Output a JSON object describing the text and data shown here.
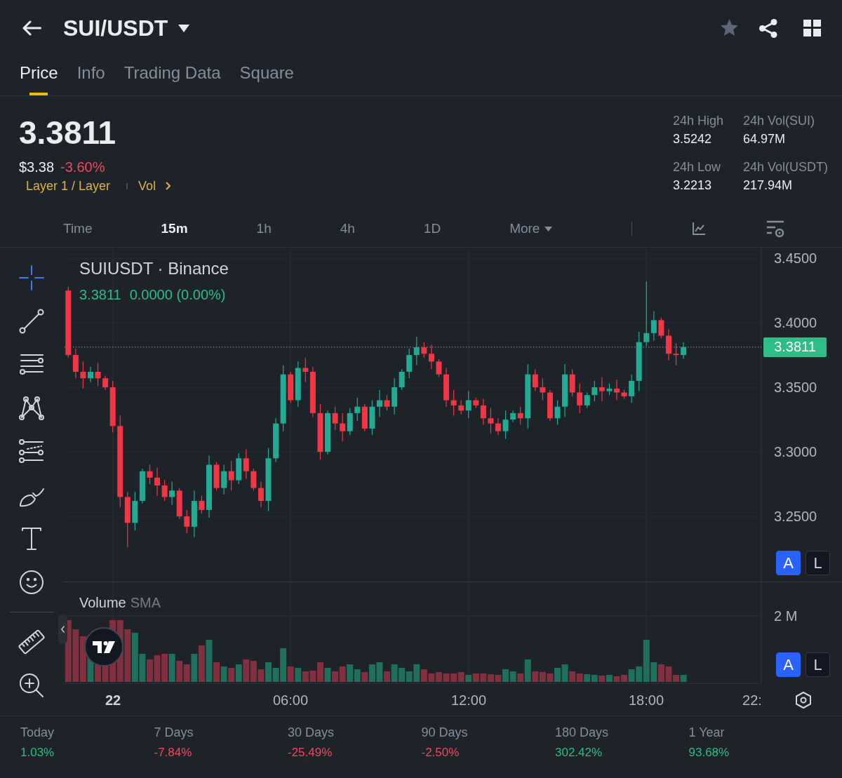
{
  "header": {
    "title": "SUI/USDT",
    "favorite": false
  },
  "tabs": [
    {
      "label": "Price",
      "selected": true
    },
    {
      "label": "Info",
      "selected": false
    },
    {
      "label": "Trading Data",
      "selected": false
    },
    {
      "label": "Square",
      "selected": false
    }
  ],
  "ticker": {
    "last_price": "3.3811",
    "usd_price": "$3.38",
    "change": "-3.60%",
    "positive": false,
    "tag": "Layer 1 / Layer",
    "link": "Vol"
  },
  "stats": [
    {
      "label": "24h High",
      "value": "3.5242"
    },
    {
      "label": "24h Vol(SUI)",
      "value": "64.97M"
    },
    {
      "label": "24h Low",
      "value": "3.2213"
    },
    {
      "label": "24h Vol(USDT)",
      "value": "217.94M"
    }
  ],
  "intervals": [
    {
      "label": "Time",
      "kind": "option",
      "selected": false
    },
    {
      "label": "15m",
      "kind": "option",
      "selected": true
    },
    {
      "label": "1h",
      "kind": "option",
      "selected": false
    },
    {
      "label": "4h",
      "kind": "option",
      "selected": false
    },
    {
      "label": "1D",
      "kind": "option",
      "selected": false
    },
    {
      "label": "More",
      "kind": "menu",
      "selected": false
    }
  ],
  "drawing_tools": [
    {
      "selected": true
    },
    {
      "selected": false
    },
    {
      "selected": false
    },
    {
      "selected": false
    },
    {
      "selected": false
    },
    {
      "selected": false
    },
    {
      "selected": false
    },
    {
      "selected": false
    },
    {
      "selected": false
    },
    {
      "selected": false
    }
  ],
  "chart": {
    "legend": {
      "symbol": "SUIUSDT · Binance",
      "price": "3.3811",
      "change": "0.0000 (0.00%)",
      "positive": true
    },
    "chart_data": {
      "type": "candlestick",
      "categories": [
        null,
        null,
        null,
        null,
        null,
        null,
        null,
        null,
        null,
        null,
        null,
        null,
        null,
        null,
        null,
        null,
        null,
        null,
        null,
        null,
        null,
        null,
        null,
        null,
        null,
        null,
        null,
        null,
        null,
        null,
        null,
        null,
        null,
        null,
        null,
        null,
        null,
        null,
        null,
        null,
        null,
        null,
        null,
        null,
        null,
        null,
        null,
        null,
        null,
        null,
        null,
        null,
        null,
        null,
        null,
        null,
        null,
        null,
        null,
        null,
        null,
        null,
        null,
        null,
        null,
        null,
        null,
        null,
        null,
        null,
        null,
        null,
        null,
        null,
        null,
        null,
        null,
        null,
        null,
        null,
        null,
        null,
        null,
        null,
        null,
        null,
        null,
        null,
        null,
        null,
        null,
        null,
        null,
        null
      ],
      "ohlc": [
        [
          3.425,
          3.428,
          3.373,
          3.375
        ],
        [
          3.375,
          3.38,
          3.357,
          3.362
        ],
        [
          3.362,
          3.37,
          3.349,
          3.357
        ],
        [
          3.357,
          3.366,
          3.354,
          3.362
        ],
        [
          3.362,
          3.369,
          3.351,
          3.357
        ],
        [
          3.357,
          3.359,
          3.348,
          3.35
        ],
        [
          3.35,
          3.355,
          3.315,
          3.32
        ],
        [
          3.32,
          3.328,
          3.257,
          3.265
        ],
        [
          3.265,
          3.269,
          3.226,
          3.245
        ],
        [
          3.245,
          3.269,
          3.239,
          3.262
        ],
        [
          3.262,
          3.287,
          3.26,
          3.285
        ],
        [
          3.285,
          3.29,
          3.275,
          3.28
        ],
        [
          3.28,
          3.288,
          3.266,
          3.274
        ],
        [
          3.274,
          3.278,
          3.262,
          3.265
        ],
        [
          3.265,
          3.277,
          3.259,
          3.27
        ],
        [
          3.27,
          3.272,
          3.248,
          3.25
        ],
        [
          3.25,
          3.255,
          3.237,
          3.242
        ],
        [
          3.242,
          3.27,
          3.234,
          3.262
        ],
        [
          3.262,
          3.266,
          3.252,
          3.255
        ],
        [
          3.255,
          3.297,
          3.249,
          3.29
        ],
        [
          3.29,
          3.292,
          3.27,
          3.272
        ],
        [
          3.272,
          3.29,
          3.267,
          3.285
        ],
        [
          3.285,
          3.293,
          3.27,
          3.278
        ],
        [
          3.278,
          3.299,
          3.275,
          3.295
        ],
        [
          3.295,
          3.302,
          3.279,
          3.285
        ],
        [
          3.285,
          3.287,
          3.27,
          3.272
        ],
        [
          3.272,
          3.277,
          3.257,
          3.262
        ],
        [
          3.262,
          3.303,
          3.254,
          3.295
        ],
        [
          3.295,
          3.326,
          3.292,
          3.322
        ],
        [
          3.322,
          3.367,
          3.316,
          3.36
        ],
        [
          3.36,
          3.362,
          3.338,
          3.34
        ],
        [
          3.34,
          3.37,
          3.335,
          3.365
        ],
        [
          3.365,
          3.373,
          3.354,
          3.362
        ],
        [
          3.362,
          3.366,
          3.327,
          3.33
        ],
        [
          3.33,
          3.337,
          3.294,
          3.3
        ],
        [
          3.3,
          3.332,
          3.298,
          3.33
        ],
        [
          3.33,
          3.335,
          3.317,
          3.322
        ],
        [
          3.322,
          3.33,
          3.308,
          3.316
        ],
        [
          3.316,
          3.334,
          3.313,
          3.33
        ],
        [
          3.33,
          3.342,
          3.324,
          3.335
        ],
        [
          3.335,
          3.337,
          3.316,
          3.318
        ],
        [
          3.318,
          3.34,
          3.313,
          3.335
        ],
        [
          3.335,
          3.348,
          3.327,
          3.34
        ],
        [
          3.34,
          3.344,
          3.332,
          3.335
        ],
        [
          3.335,
          3.357,
          3.329,
          3.35
        ],
        [
          3.35,
          3.364,
          3.348,
          3.362
        ],
        [
          3.362,
          3.38,
          3.357,
          3.375
        ],
        [
          3.375,
          3.389,
          3.367,
          3.381
        ],
        [
          3.381,
          3.385,
          3.373,
          3.376
        ],
        [
          3.376,
          3.383,
          3.364,
          3.37
        ],
        [
          3.37,
          3.372,
          3.358,
          3.36
        ],
        [
          3.36,
          3.365,
          3.335,
          3.34
        ],
        [
          3.34,
          3.348,
          3.328,
          3.336
        ],
        [
          3.336,
          3.34,
          3.329,
          3.332
        ],
        [
          3.332,
          3.347,
          3.326,
          3.34
        ],
        [
          3.34,
          3.342,
          3.334,
          3.336
        ],
        [
          3.336,
          3.341,
          3.321,
          3.326
        ],
        [
          3.326,
          3.334,
          3.314,
          3.322
        ],
        [
          3.322,
          3.326,
          3.313,
          3.316
        ],
        [
          3.316,
          3.332,
          3.31,
          3.325
        ],
        [
          3.325,
          3.332,
          3.323,
          3.33
        ],
        [
          3.33,
          3.335,
          3.321,
          3.326
        ],
        [
          3.326,
          3.368,
          3.318,
          3.36
        ],
        [
          3.36,
          3.364,
          3.347,
          3.35
        ],
        [
          3.35,
          3.357,
          3.34,
          3.346
        ],
        [
          3.346,
          3.348,
          3.324,
          3.326
        ],
        [
          3.326,
          3.34,
          3.321,
          3.335
        ],
        [
          3.335,
          3.368,
          3.327,
          3.36
        ],
        [
          3.36,
          3.364,
          3.343,
          3.346
        ],
        [
          3.346,
          3.353,
          3.33,
          3.336
        ],
        [
          3.336,
          3.346,
          3.334,
          3.344
        ],
        [
          3.344,
          3.355,
          3.339,
          3.35
        ],
        [
          3.35,
          3.358,
          3.339,
          3.347
        ],
        [
          3.347,
          3.353,
          3.344,
          3.349
        ],
        [
          3.349,
          3.356,
          3.34,
          3.346
        ],
        [
          3.346,
          3.348,
          3.341,
          3.343
        ],
        [
          3.343,
          3.36,
          3.338,
          3.355
        ],
        [
          3.355,
          3.393,
          3.347,
          3.385
        ],
        [
          3.385,
          3.432,
          3.382,
          3.392
        ],
        [
          3.392,
          3.409,
          3.386,
          3.402
        ],
        [
          3.402,
          3.404,
          3.388,
          3.39
        ],
        [
          3.39,
          3.395,
          3.371,
          3.376
        ],
        [
          3.376,
          3.384,
          3.367,
          3.375
        ],
        [
          3.375,
          3.385,
          3.372,
          3.3811
        ],
        null,
        null,
        null,
        null,
        null,
        null,
        null,
        null,
        null,
        null
      ],
      "ylim": [
        3.1207,
        3.4582
      ],
      "yticks": [
        {
          "value": 3.45,
          "label": "3.4500"
        },
        {
          "value": 3.4,
          "label": "3.4000"
        },
        {
          "value": 3.35,
          "label": "3.3500"
        },
        {
          "value": 3.3,
          "label": "3.3000"
        },
        {
          "value": 3.25,
          "label": "3.2500"
        }
      ],
      "grid": true,
      "ref_lines": [
        {
          "axis": "y",
          "value": 3.3811
        }
      ]
    },
    "last_price": {
      "value": "3.3811",
      "positive": true
    },
    "price_scale_buttons": [
      {
        "label": "A",
        "on": true
      },
      {
        "label": "L",
        "on": false
      }
    ],
    "volume": {
      "title": "Volume",
      "indicator": "SMA",
      "axis": [
        "2 M"
      ]
    },
    "volume_scale_buttons": [
      {
        "label": "A",
        "on": true
      },
      {
        "label": "L",
        "on": false
      }
    ],
    "time_axis": [
      {
        "label": "22",
        "kind": "day"
      },
      {
        "label": "06:00",
        "kind": "time"
      },
      {
        "label": "12:00",
        "kind": "time"
      },
      {
        "label": "18:00",
        "kind": "time"
      },
      {
        "label": "22:",
        "kind": "time"
      }
    ]
  },
  "periods": [
    {
      "label": "Today",
      "value": "1.03%",
      "positive": true
    },
    {
      "label": "7 Days",
      "value": "-7.84%",
      "positive": false
    },
    {
      "label": "30 Days",
      "value": "-25.49%",
      "positive": false
    },
    {
      "label": "90 Days",
      "value": "-2.50%",
      "positive": false
    },
    {
      "label": "180 Days",
      "value": "302.42%",
      "positive": true
    },
    {
      "label": "1 Year",
      "value": "93.68%",
      "positive": true
    }
  ]
}
